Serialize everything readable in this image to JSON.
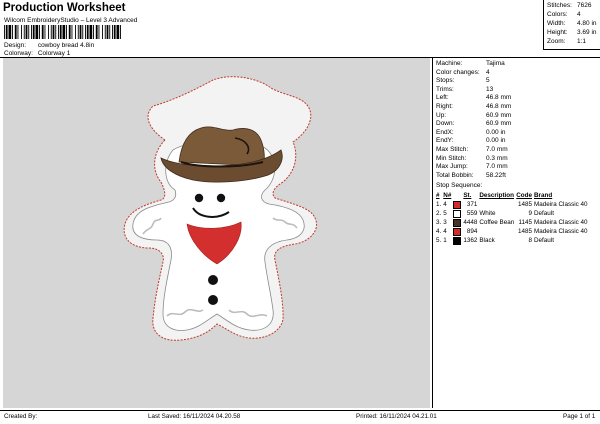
{
  "header": {
    "title": "Production Worksheet",
    "subtitle": "Wilcom EmbroideryStudio – Level 3 Advanced",
    "design_label": "Design:",
    "design_value": "cowboy bread 4.8in",
    "colorway_label": "Colorway:",
    "colorway_value": "Colorway 1"
  },
  "stats": {
    "stitches_label": "Stitches:",
    "stitches_value": "7626",
    "colors_label": "Colors:",
    "colors_value": "4",
    "width_label": "Width:",
    "width_value": "4.80 in",
    "height_label": "Height:",
    "height_value": "3.69 in",
    "zoom_label": "Zoom:",
    "zoom_value": "1:1"
  },
  "machine_info": [
    {
      "label": "Machine:",
      "value": "Tajima"
    },
    {
      "label": "Color changes:",
      "value": "4"
    },
    {
      "label": "Stops:",
      "value": "5"
    },
    {
      "label": "Trims:",
      "value": "13"
    },
    {
      "label": "Left:",
      "value": "46.8 mm"
    },
    {
      "label": "Right:",
      "value": "46.8 mm"
    },
    {
      "label": "Up:",
      "value": "60.9 mm"
    },
    {
      "label": "Down:",
      "value": "60.9 mm"
    },
    {
      "label": "EndX:",
      "value": "0.00 in"
    },
    {
      "label": "EndY:",
      "value": "0.00 in"
    },
    {
      "label": "Max Stitch:",
      "value": "7.0 mm"
    },
    {
      "label": "Min Stitch:",
      "value": "0.3 mm"
    },
    {
      "label": "Max Jump:",
      "value": "7.0 mm"
    },
    {
      "label": "Total Bobbin:",
      "value": "58.22ft"
    }
  ],
  "stop_sequence": {
    "title": "Stop Sequence:",
    "headers": {
      "hash": "#",
      "n": "N#",
      "st": "St.",
      "description": "Description",
      "code": "Code",
      "brand": "Brand"
    },
    "rows": [
      {
        "idx": "1.",
        "n": "4",
        "color": "#d42a2a",
        "st": "371",
        "description": "",
        "code": "1485",
        "brand": "Madeira Classic 40"
      },
      {
        "idx": "2.",
        "n": "5",
        "color": "#ffffff",
        "st": "559",
        "description": "White",
        "code": "9",
        "brand": "Default"
      },
      {
        "idx": "3.",
        "n": "3",
        "color": "#4a3322",
        "st": "4448",
        "description": "Coffee Bean",
        "code": "1145",
        "brand": "Madeira Classic 40"
      },
      {
        "idx": "4.",
        "n": "4",
        "color": "#d42a2a",
        "st": "894",
        "description": "",
        "code": "1485",
        "brand": "Madeira Classic 40"
      },
      {
        "idx": "5.",
        "n": "1",
        "color": "#000000",
        "st": "1362",
        "description": "Black",
        "code": "8",
        "brand": "Default"
      }
    ]
  },
  "footer": {
    "created_by": "Created By:",
    "last_saved": "Last Saved: 16/11/2024 04.20.58",
    "printed": "Printed: 16/11/2024 04.21.01",
    "page": "Page 1 of 1"
  },
  "colors": {
    "canvas": "#d6d6d6",
    "hat": "#7b5a3a",
    "hat_dark": "#3f2c1c",
    "bandana": "#d32f2f",
    "cookie": "#ffffff",
    "outline_stitch": "#c0392b"
  }
}
